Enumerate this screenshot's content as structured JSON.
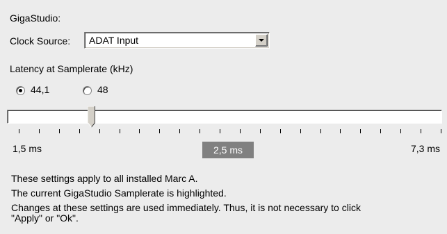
{
  "section_title": "GigaStudio:",
  "clock_source": {
    "label": "Clock Source:",
    "value": "ADAT Input",
    "dropdown_icon": "chevron-down-icon"
  },
  "latency": {
    "title": "Latency at Samplerate (kHz)",
    "options": [
      {
        "label": "44,1",
        "selected": true
      },
      {
        "label": "48",
        "selected": false
      }
    ],
    "slider": {
      "min_label": "1,5 ms",
      "max_label": "7,3 ms",
      "current_label": "2,5 ms",
      "min": 1.5,
      "max": 7.3,
      "value": 2.5,
      "tick_count": 22
    }
  },
  "info": {
    "line1": "These settings apply to all installed Marc A.",
    "line2": "The current GigaStudio Samplerate is highlighted.",
    "line3a": "Changes at these settings are used immediately. Thus, it is not necessary to click",
    "line3b": "\"Apply\" or \"Ok\"."
  }
}
